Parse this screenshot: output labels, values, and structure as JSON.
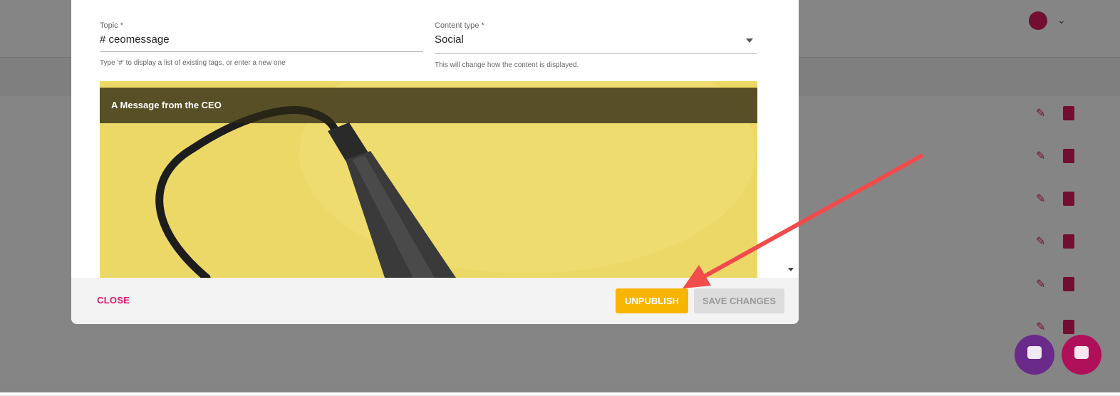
{
  "modal": {
    "topic": {
      "label": "Topic *",
      "value": "# ceomessage",
      "hint": "Type '#' to display a list of existing tags, or enter a new one"
    },
    "content_type": {
      "label": "Content type *",
      "value": "Social",
      "hint": "This will change how the content is displayed."
    },
    "preview": {
      "title": "A Message from the CEO"
    },
    "footer": {
      "close_label": "CLOSE",
      "unpublish_label": "UNPUBLISH",
      "save_label": "SAVE CHANGES"
    }
  },
  "colors": {
    "accent": "#e0166c",
    "unpublish": "#f7b500",
    "annotation_arrow": "#f24b4b"
  },
  "icons": [
    "chevron-down-icon",
    "scroll-down-icon",
    "edit-icon",
    "delete-icon",
    "chat-icon"
  ]
}
